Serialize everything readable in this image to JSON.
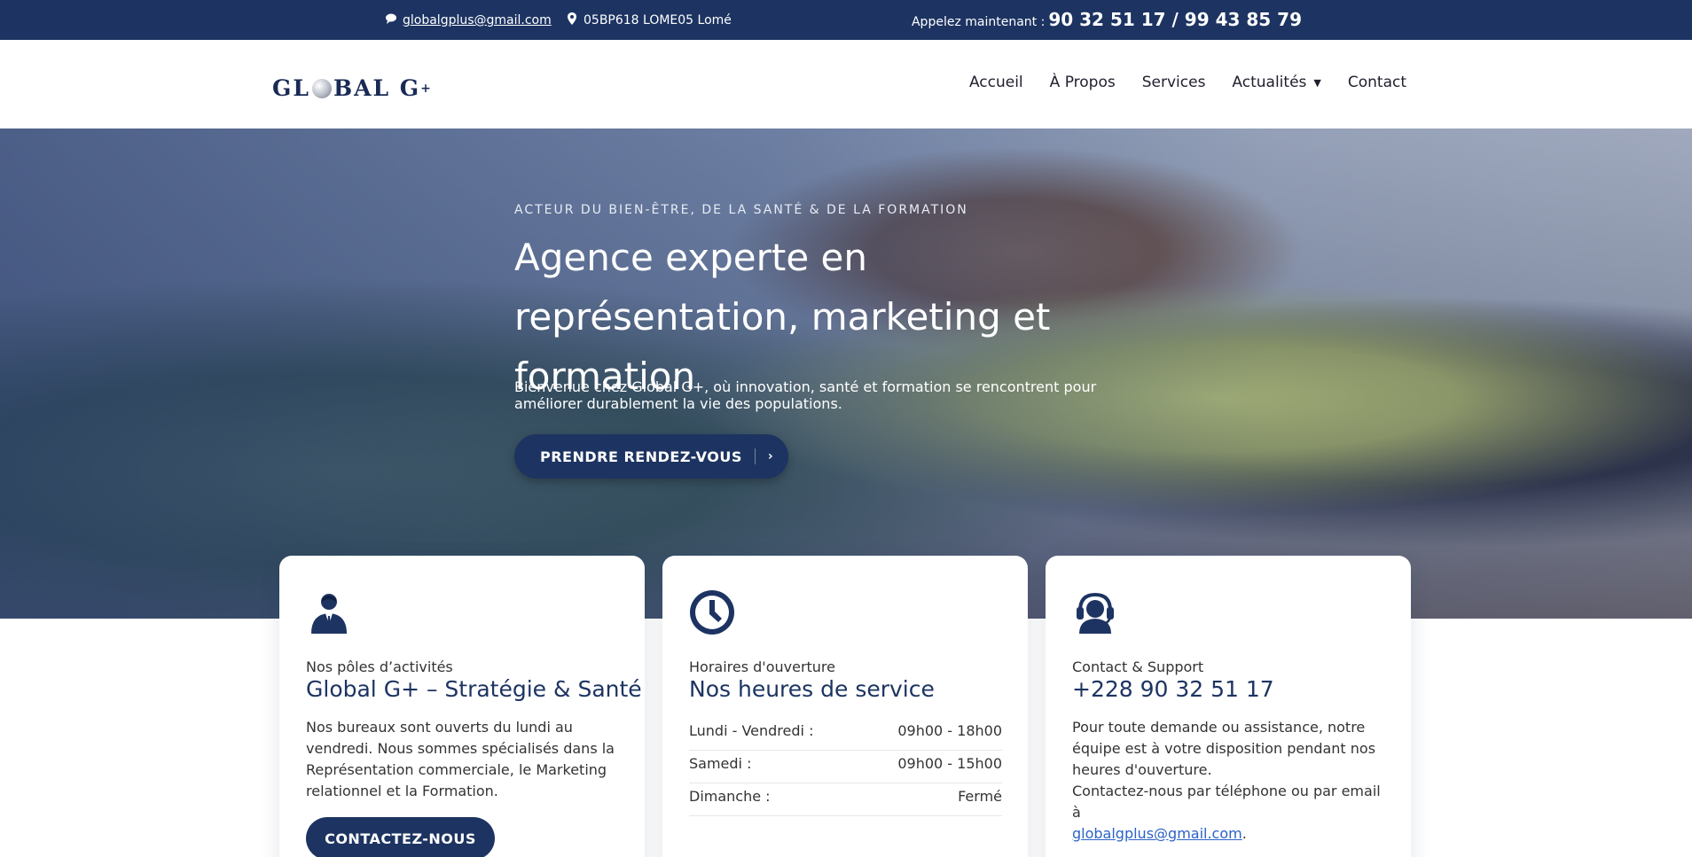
{
  "topbar": {
    "email": "globalgplus@gmail.com",
    "address": "05BP618 LOME05 Lomé",
    "call_label": "Appelez maintenant :",
    "call_numbers": "90 32 51 17 / 99 43 85 79"
  },
  "brand": {
    "logo_left": "GL",
    "logo_right": "BAL G",
    "logo_plus": "+"
  },
  "nav": {
    "items": [
      {
        "label": "Accueil"
      },
      {
        "label": "À Propos"
      },
      {
        "label": "Services"
      },
      {
        "label": "Actualités"
      },
      {
        "label": "Contact"
      }
    ]
  },
  "hero": {
    "kicker": "ACTEUR DU BIEN-ÊTRE, DE LA SANTÉ & DE LA FORMATION",
    "title": "Agence experte en représentation, marketing et formation",
    "intro": "Bienvenue chez Global G+, où innovation, santé et formation se rencontrent pour améliorer durablement la vie des populations.",
    "cta": "PRENDRE RENDEZ-VOUS"
  },
  "cards": {
    "activities": {
      "label": "Nos pôles d’activités",
      "title": "Global G+ – Stratégie & Santé",
      "body": "Nos bureaux sont ouverts du lundi au vendredi. Nous sommes spécialisés dans la Représentation commerciale, le Marketing relationnel et la Formation.",
      "button": "CONTACTEZ-NOUS"
    },
    "hours": {
      "label": "Horaires d'ouverture",
      "title": "Nos heures de service",
      "rows": [
        {
          "day": "Lundi - Vendredi :",
          "time": "09h00 - 18h00"
        },
        {
          "day": "Samedi :",
          "time": "09h00 - 15h00"
        },
        {
          "day": "Dimanche :",
          "time": "Fermé"
        }
      ]
    },
    "support": {
      "label": "Contact & Support",
      "title": "+228 90 32 51 17",
      "body_line1": "Pour toute demande ou assistance, notre équipe est à votre disposition pendant nos heures d'ouverture.",
      "body_line2": "Contactez-nous par téléphone ou par email à",
      "email": "globalgplus@gmail.com",
      "period": "."
    }
  },
  "colors": {
    "primary": "#1d3462",
    "link": "#2b63c5"
  },
  "icons": [
    "chat-icon",
    "location-pin-icon",
    "caret-down-icon",
    "chevron-right-icon",
    "user-business-icon",
    "clock-icon",
    "headset-support-icon",
    "globe-icon"
  ]
}
